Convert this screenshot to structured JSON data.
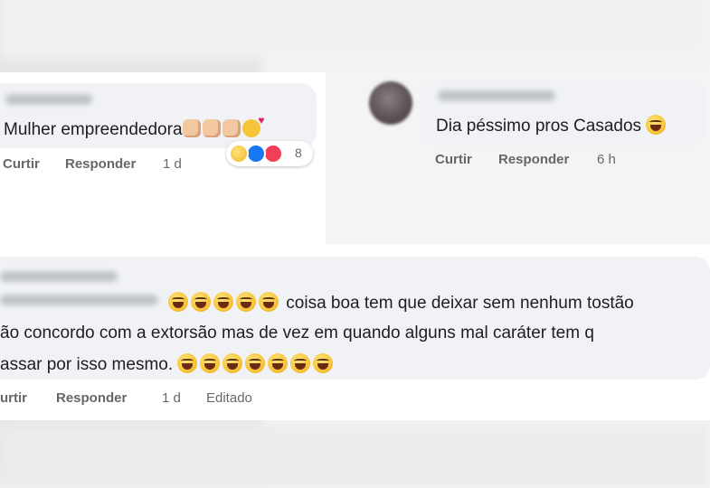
{
  "comments": [
    {
      "text": "Mulher empreendedora",
      "reaction_count": "8",
      "actions": {
        "like": "Curtir",
        "reply": "Responder",
        "time": "1 d"
      }
    },
    {
      "text": "Dia péssimo pros Casados",
      "actions": {
        "like": "Curtir",
        "reply": "Responder",
        "time": "6 h"
      }
    },
    {
      "line1": "coisa boa tem que deixar sem nenhum tostão",
      "line2": "ão concordo com a extorsão mas de vez em quando alguns mal caráter tem q",
      "line3": "assar por isso mesmo.",
      "actions": {
        "like": "urtir",
        "reply": "Responder",
        "time": "1 d",
        "edited": "Editado"
      }
    }
  ],
  "icons": {
    "laugh_emoji": "laughing-face",
    "clap_emoji": "clapping-hands",
    "heart_face_emoji": "smiling-face-with-hearts",
    "reactions": [
      "haha",
      "like",
      "love"
    ]
  },
  "colors": {
    "bubble": "#f0f2f5",
    "action_text": "#65676b",
    "like_blue": "#1877f2",
    "love_red": "#f33e58"
  }
}
